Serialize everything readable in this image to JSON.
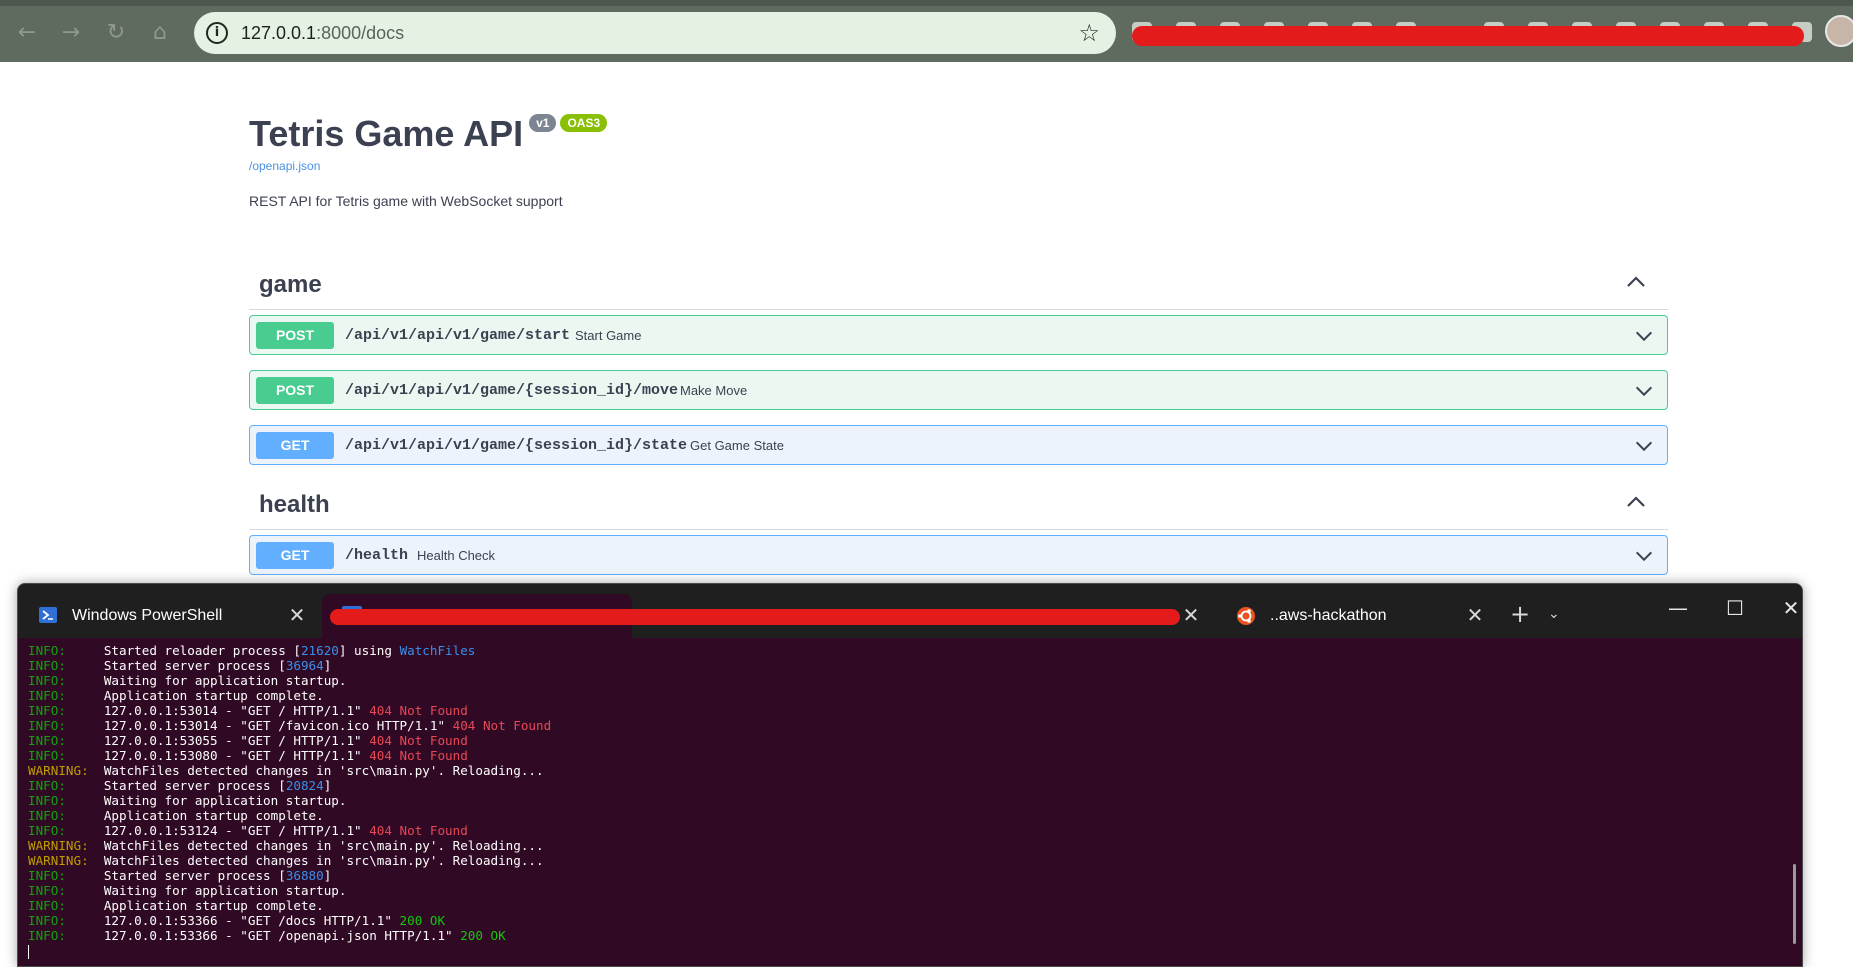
{
  "browser": {
    "url_host": "127.0.0.1",
    "url_rest": ":8000/docs"
  },
  "swagger": {
    "title": "Tetris Game API",
    "version_badge": "v1",
    "oas_badge": "OAS3",
    "spec_link": "/openapi.json",
    "description": "REST API for Tetris game with WebSocket support",
    "tags": [
      {
        "name": "game",
        "operations": [
          {
            "method": "POST",
            "path": "/api/v1/api/v1/game/start",
            "summary": "Start Game"
          },
          {
            "method": "POST",
            "path": "/api/v1/api/v1/game/{session_id}/move",
            "summary": "Make Move"
          },
          {
            "method": "GET",
            "path": "/api/v1/api/v1/game/{session_id}/state",
            "summary": "Get Game State"
          }
        ]
      },
      {
        "name": "health",
        "operations": [
          {
            "method": "GET",
            "path": "/health",
            "summary": "Health Check"
          }
        ]
      }
    ]
  },
  "terminal": {
    "tabs": [
      {
        "label": "Windows PowerShell"
      },
      {
        "label": "..aws-hackathon"
      }
    ],
    "plus_glyph": "+",
    "dropdown_glyph": "⌄",
    "win_minimize": "—",
    "win_maximize": "☐",
    "win_close": "✕",
    "tab_close": "✕",
    "log": [
      {
        "level": "INFO:",
        "pre": "     Started reloader process [",
        "num": "21620",
        "post": "] using ",
        "watch": "WatchFiles"
      },
      {
        "level": "INFO:",
        "pre": "     Started server process [",
        "num": "36964",
        "post": "]"
      },
      {
        "level": "INFO:",
        "pre": "     Waiting for application startup."
      },
      {
        "level": "INFO:",
        "pre": "     Application startup complete."
      },
      {
        "level": "INFO:",
        "pre": "     127.0.0.1:53014 - \"GET / HTTP/1.1\" ",
        "err": "404 Not Found"
      },
      {
        "level": "INFO:",
        "pre": "     127.0.0.1:53014 - \"GET /favicon.ico HTTP/1.1\" ",
        "err": "404 Not Found"
      },
      {
        "level": "INFO:",
        "pre": "     127.0.0.1:53055 - \"GET / HTTP/1.1\" ",
        "err": "404 Not Found"
      },
      {
        "level": "INFO:",
        "pre": "     127.0.0.1:53080 - \"GET / HTTP/1.1\" ",
        "err": "404 Not Found"
      },
      {
        "level": "WARNING:",
        "pre": "  WatchFiles detected changes in 'src\\main.py'. Reloading..."
      },
      {
        "level": "INFO:",
        "pre": "     Started server process [",
        "num": "20824",
        "post": "]"
      },
      {
        "level": "INFO:",
        "pre": "     Waiting for application startup."
      },
      {
        "level": "INFO:",
        "pre": "     Application startup complete."
      },
      {
        "level": "INFO:",
        "pre": "     127.0.0.1:53124 - \"GET / HTTP/1.1\" ",
        "err": "404 Not Found"
      },
      {
        "level": "WARNING:",
        "pre": "  WatchFiles detected changes in 'src\\main.py'. Reloading..."
      },
      {
        "level": "WARNING:",
        "pre": "  WatchFiles detected changes in 'src\\main.py'. Reloading..."
      },
      {
        "level": "INFO:",
        "pre": "     Started server process [",
        "num": "36880",
        "post": "]"
      },
      {
        "level": "INFO:",
        "pre": "     Waiting for application startup."
      },
      {
        "level": "INFO:",
        "pre": "     Application startup complete."
      },
      {
        "level": "INFO:",
        "pre": "     127.0.0.1:53366 - \"GET /docs HTTP/1.1\" ",
        "ok": "200 OK"
      },
      {
        "level": "INFO:",
        "pre": "     127.0.0.1:53366 - \"GET /openapi.json HTTP/1.1\" ",
        "ok": "200 OK"
      }
    ]
  },
  "colors": {
    "post": "#49cc90",
    "get": "#61affe",
    "terminal_bg": "#300a24",
    "redaction": "#e31b1b"
  },
  "icons": [
    "info-icon",
    "star-icon",
    "chevron-up-icon",
    "chevron-down-icon",
    "powershell-icon",
    "ubuntu-icon",
    "avatar"
  ]
}
